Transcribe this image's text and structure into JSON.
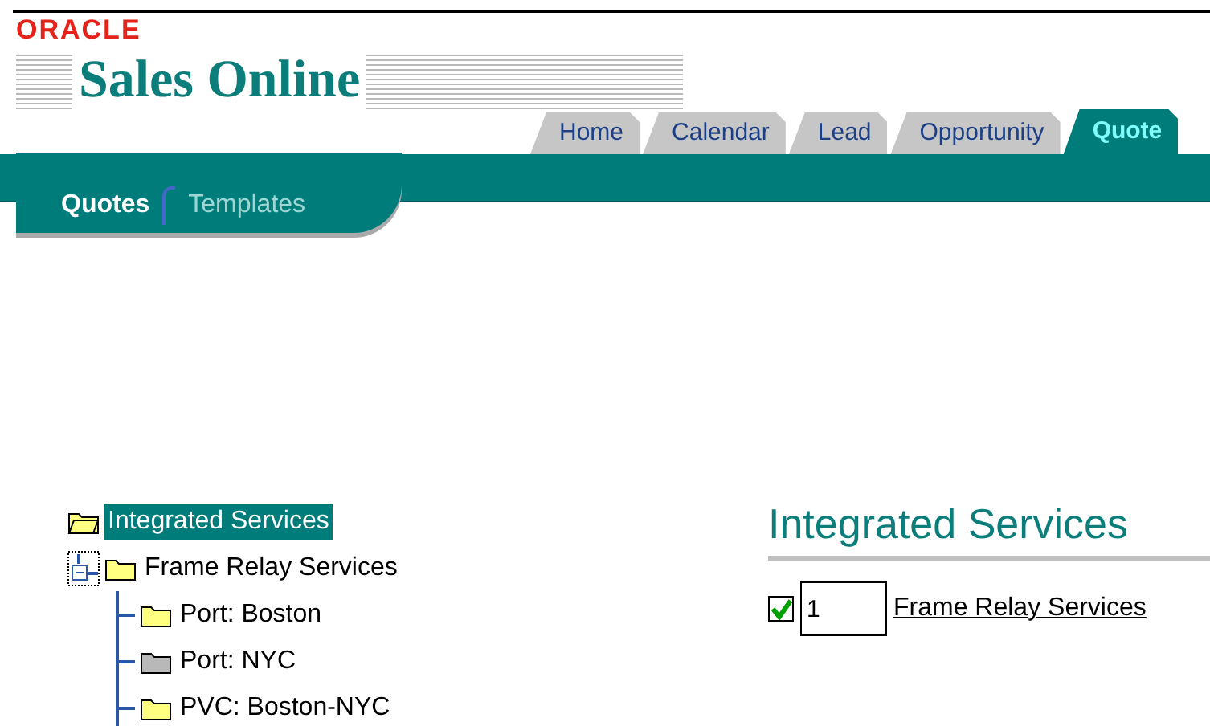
{
  "brand": {
    "company": "ORACLE",
    "product": "Sales Online"
  },
  "tabs": [
    {
      "label": "Home",
      "selected": false
    },
    {
      "label": "Calendar",
      "selected": false
    },
    {
      "label": "Lead",
      "selected": false
    },
    {
      "label": "Opportunity",
      "selected": false
    },
    {
      "label": "Quote",
      "selected": true
    }
  ],
  "subtabs": [
    {
      "label": "Quotes",
      "selected": true
    },
    {
      "label": "Templates",
      "selected": false
    }
  ],
  "tree": [
    {
      "label": "Integrated Services",
      "selected": true,
      "expanded": true,
      "color": "#ffff80",
      "children": [
        {
          "label": "Frame Relay Services",
          "selected": false,
          "expanded": true,
          "color": "#ffff80",
          "children": [
            {
              "label": "Port: Boston",
              "selected": false,
              "color": "#ffff80"
            },
            {
              "label": "Port: NYC",
              "selected": false,
              "color": "#b8b8b8"
            },
            {
              "label": "PVC: Boston-NYC",
              "selected": false,
              "color": "#ffff80"
            }
          ]
        }
      ]
    }
  ],
  "detail": {
    "heading": "Integrated Services",
    "items": [
      {
        "checked": true,
        "quantity": "1",
        "label": "Frame Relay Services"
      }
    ]
  }
}
